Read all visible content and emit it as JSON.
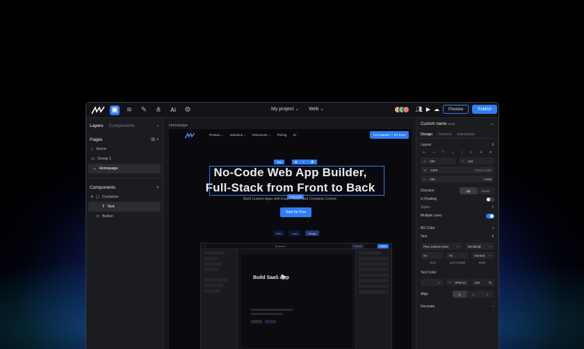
{
  "topbar": {
    "project": "My project ⌄",
    "mode": "Web ⌄",
    "preview": "Preview",
    "publish": "Publish",
    "ai": "Ai"
  },
  "left": {
    "tab_layers": "Layers",
    "tab_components": "Components",
    "pages_title": "Pages",
    "pages": [
      "Home",
      "Group 1",
      "Homepage"
    ],
    "components_title": "Components",
    "components": [
      "Container",
      "Text",
      "Button"
    ]
  },
  "canvas": {
    "breadcrumb": "Homepage",
    "nav": [
      "Product ⌄",
      "Solutions ⌄",
      "Resources ⌄",
      "Pricing"
    ],
    "nav_ai": "Ai",
    "get_started": "Get Started — It's Free",
    "hero_line1": "No-Code Web App Builder,",
    "hero_line2": "Full-Stack from Front to Back",
    "text_badge": "Text",
    "size_badge": "1000×230",
    "subtitle": "Build Custom Apps with Ease, Power, and Complete Control.",
    "cta": "Start for Free",
    "pills": [
      "Data",
      "Logic",
      "Design"
    ],
    "mini_title": "Build SaaS App",
    "mini_project": "My project ⌄",
    "mini_preview": "Preview",
    "mini_publish": "Publish"
  },
  "right": {
    "title": "Custom name",
    "title_tag": "(text)",
    "tabs": [
      "Design",
      "Content",
      "Interaction"
    ],
    "layout": "Layout",
    "x": "150",
    "y": "110",
    "w": "1000",
    "w_mode": "Fixed Width",
    "h": "230",
    "h_mode": "Fixed",
    "direction": "Direction",
    "dir_up": "Up",
    "dir_down": "Down",
    "is_floating": "Is Floating",
    "styles": "Styles",
    "multiple_lines": "Multiple Lines",
    "bg_color": "BG Color",
    "text": "Text",
    "font": "Plus Jakarta Sans",
    "weight": "Semibold",
    "size": "54",
    "line_height": "70",
    "style": "Normal",
    "cap_size": "Size",
    "cap_line": "Line Height",
    "cap_style": "Style",
    "text_color": "Text Color",
    "color_hex": "0F0F10",
    "opacity": "100",
    "align": "Align",
    "decorate": "Decorate"
  }
}
